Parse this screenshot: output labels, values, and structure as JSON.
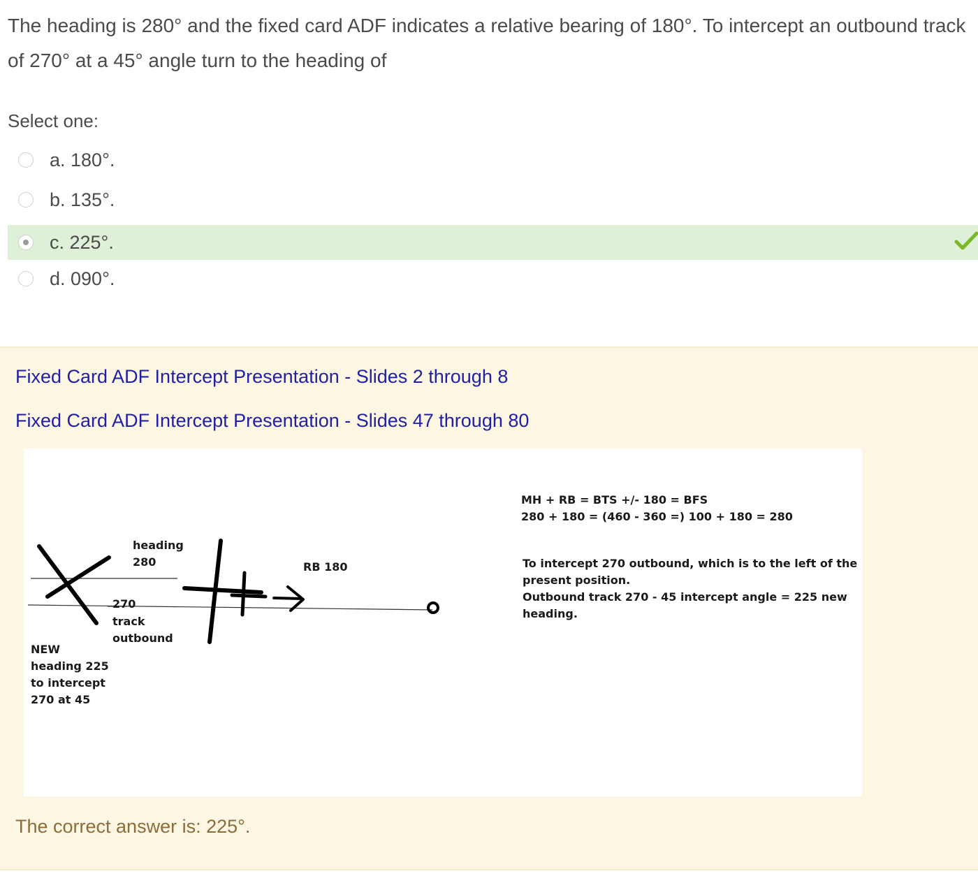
{
  "question": {
    "text": "The heading is 280° and the fixed card ADF indicates a relative bearing of 180°. To intercept an outbound track of 270° at a 45° angle turn to the heading of"
  },
  "prompt": "Select one:",
  "options": [
    {
      "label": "a. 180°.",
      "selected": false
    },
    {
      "label": "b. 135°.",
      "selected": false
    },
    {
      "label": "c. 225°.",
      "selected": true,
      "correct": true
    },
    {
      "label": "d. 090°.",
      "selected": false
    }
  ],
  "feedback": {
    "links": [
      "Fixed Card ADF Intercept Presentation - Slides 2 through 8",
      "Fixed Card ADF Intercept Presentation - Slides 47 through 80"
    ],
    "diagram": {
      "heading_label": "heading\n280",
      "rb_label": "RB 180",
      "track_label_number": "270",
      "track_label_text": "track\noutbound",
      "new_heading_label": "NEW\nheading 225\nto intercept\n270 at 45",
      "formula": "MH + RB = BTS +/- 180 = BFS\n280 + 180 = (460 - 360 =) 100 + 180 = 280",
      "explanation": "To intercept 270 outbound, which is to the left of the\npresent position.\nOutbound track 270 - 45 intercept angle =  225 new\nheading."
    },
    "answer": "The correct answer is: 225°."
  },
  "colors": {
    "selected_bg": "#dff0d8",
    "check": "#7ab828",
    "link": "#1f1fa8",
    "feedback_bg": "#fcf6e3",
    "answer_text": "#8a6d3b"
  }
}
